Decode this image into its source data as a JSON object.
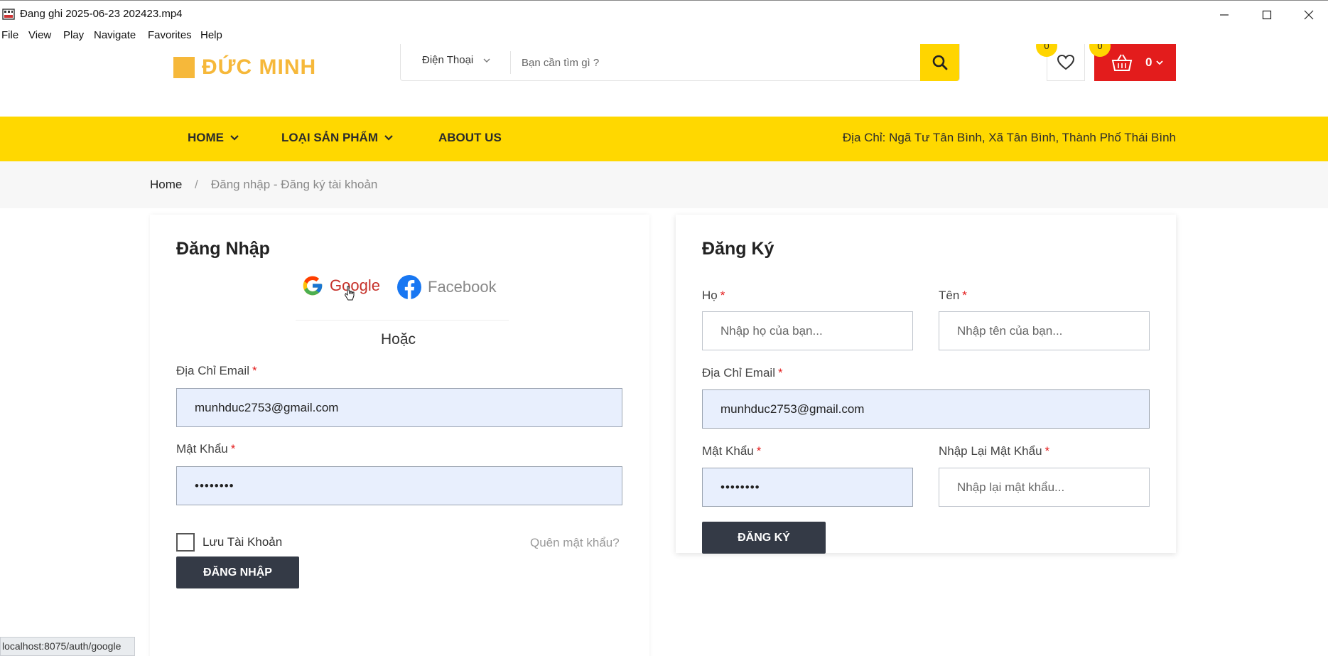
{
  "window": {
    "title": "Đang ghi 2025-06-23 202423.mp4",
    "menu": [
      "File",
      "View",
      "Play",
      "Navigate",
      "Favorites",
      "Help"
    ]
  },
  "header": {
    "logo_text": "ĐỨC MINH",
    "search_category": "Điện Thoại",
    "search_placeholder": "Bạn cần tìm gì ?",
    "wishlist_count": "0",
    "cart_count_badge": "0",
    "cart_label": "0"
  },
  "nav": {
    "items": [
      "HOME",
      "LOẠI SẢN PHẨM",
      "ABOUT US"
    ],
    "address": "Địa Chỉ: Ngã Tư Tân Bình, Xã Tân Bình, Thành Phố Thái Bình"
  },
  "breadcrumb": {
    "home": "Home",
    "separator": "/",
    "current": "Đăng nhập - Đăng ký tài khoản"
  },
  "login": {
    "title": "Đăng Nhập",
    "google": "Google",
    "facebook": "Facebook",
    "or": "Hoặc",
    "email_label": "Địa Chỉ Email",
    "email_value": "munhduc2753@gmail.com",
    "password_label": "Mật Khẩu",
    "password_value": "••••••••",
    "remember": "Lưu Tài Khoản",
    "forgot": "Quên mật khẩu?",
    "submit": "ĐĂNG NHẬP",
    "required_mark": "*"
  },
  "register": {
    "title": "Đăng Ký",
    "lastname_label": "Họ",
    "lastname_placeholder": "Nhập họ của bạn...",
    "firstname_label": "Tên",
    "firstname_placeholder": "Nhập tên của bạn...",
    "email_label": "Địa Chỉ Email",
    "email_value": "munhduc2753@gmail.com",
    "password_label": "Mật Khẩu",
    "password_value": "••••••••",
    "confirm_label": "Nhập Lại Mật Khẩu",
    "confirm_placeholder": "Nhập lại mật khẩu...",
    "submit": "ĐĂNG KÝ",
    "required_mark": "*"
  },
  "status_url": "localhost:8075/auth/google",
  "colors": {
    "brand_yellow": "#ffd800",
    "logo_orange": "#f6b83a",
    "cart_red": "#e31c1c",
    "dark_button": "#343a46",
    "filled_input": "#e8effd"
  }
}
